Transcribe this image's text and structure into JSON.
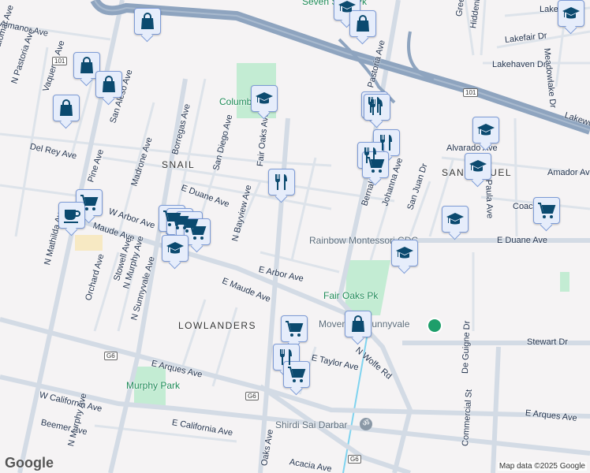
{
  "map": {
    "streets": [
      "Almanor Ave",
      "N Pastoria Ave",
      "Palomar Ave",
      "Vaqueros Ave",
      "San Aleso Ave",
      "Del Rey Ave",
      "Pine Ave",
      "Madrone Ave",
      "Borregas Ave",
      "San Diego Ave",
      "N Bayview Ave",
      "E Duane Ave",
      "W Arbor Ave",
      "Maude Ave",
      "N Mathilda Ave",
      "Orchard Ave",
      "Stowell Ave",
      "N Murphy Ave",
      "N Sunnyvale Ave",
      "E Arbor Ave",
      "E Maude Ave",
      "E Arques Ave",
      "W California Ave",
      "Beemer Ave",
      "N Murphy Ave",
      "E California Ave",
      "Oaks Ave",
      "Acacia Ave",
      "E Taylor Ave",
      "N Wolfe Rd",
      "Stewart Dr",
      "De Guigne Dr",
      "Commercial St",
      "E Arques Ave",
      "E Duane Ave",
      "Bernal Ave",
      "Johanna Ave",
      "San Juan Dr",
      "Alvarado Ave",
      "Amador Ave",
      "Coach Dr",
      "Santa Paula Ave",
      "Lakehaven Dr",
      "Lakefair Dr",
      "Hiddenlake Dr",
      "Greenlake Dr",
      "Lakewood Dr",
      "Meadowlake Dr",
      "Lake Dr",
      "Fair Oaks Ave",
      "Pastoria Ave"
    ],
    "neighborhoods": [
      "SNAIL",
      "LOWLANDERS",
      "SAN MIGUEL"
    ],
    "parks": [
      "Columbia",
      "Seven Seas Pk",
      "Fair Oaks Pk",
      "Murphy Park"
    ],
    "pois": [
      "Rainbow Montessori CDC",
      "Movement Sunnyvale",
      "Shirdi Sai Darbar"
    ],
    "shields": [
      "101",
      "101",
      "G6",
      "G6",
      "G6"
    ],
    "markers": [
      "shopping-bag",
      "shopping-bag",
      "shopping-bag",
      "shopping-bag",
      "school",
      "school",
      "shopping-bag",
      "school",
      "restaurant",
      "restaurant",
      "restaurant",
      "restaurant",
      "shopping-cart",
      "school",
      "school",
      "school",
      "shopping-cart",
      "school",
      "restaurant",
      "shopping-cart",
      "coffee",
      "shopping-cart",
      "shopping-cart",
      "shopping-cart",
      "shopping-cart",
      "school",
      "shopping-cart",
      "restaurant",
      "shopping-cart",
      "shopping-bag"
    ],
    "attribution": "Map data ©2025 Google",
    "logo": "Google",
    "colors": {
      "marker_bg": "#e6edfb",
      "marker_border": "#7d9bd6",
      "icon": "#0b4a6f",
      "highway": "#8ea4bf",
      "road": "#d6dde6",
      "park": "#c3ecd3",
      "water": "#7fd3ef"
    }
  }
}
